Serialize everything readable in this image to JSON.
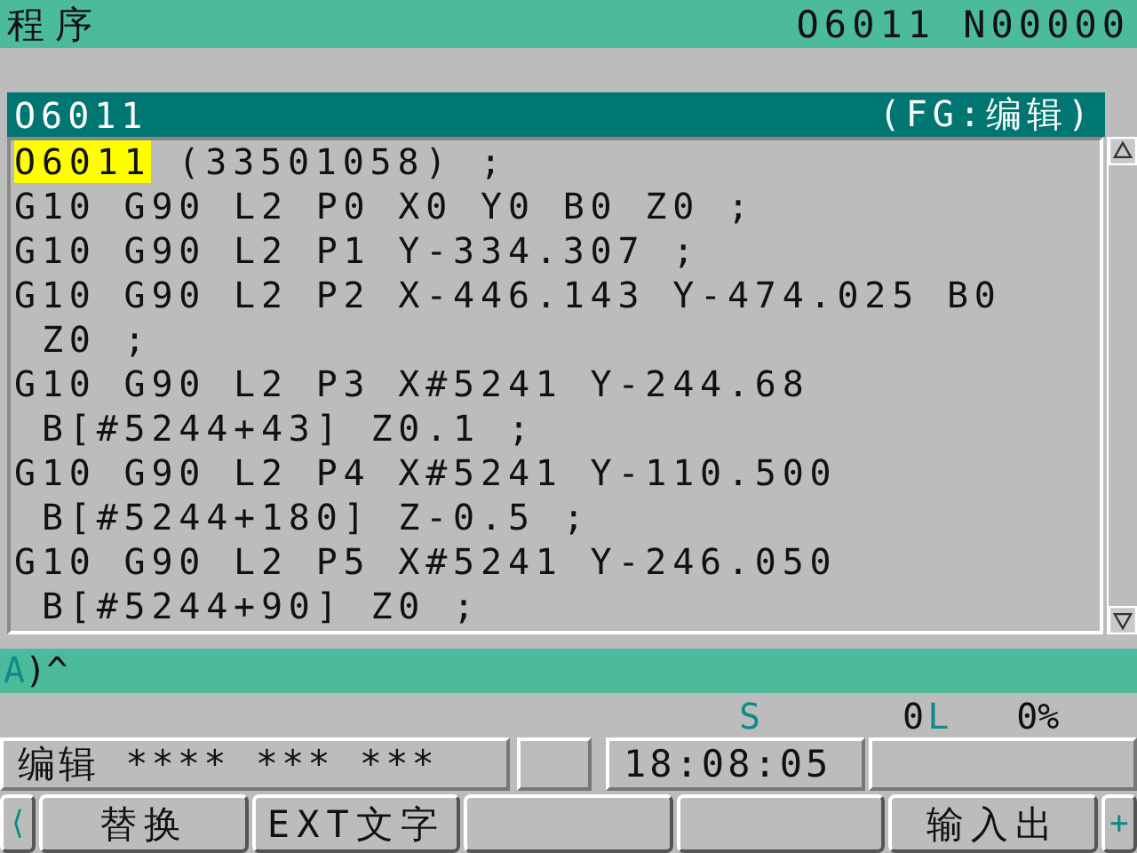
{
  "header": {
    "title": "程序",
    "program": "O6011 N00000"
  },
  "program_bar": {
    "name": "O6011",
    "mode": "(FG:编辑)"
  },
  "editor": {
    "lines": [
      {
        "cursor_word": "O6011",
        "text": "(33501058) ;"
      },
      {
        "text": "G10 G90 L2 P0 X0 Y0 B0 Z0 ;"
      },
      {
        "text": "G10 G90 L2 P1 Y-334.307 ;"
      },
      {
        "text": "G10 G90 L2 P2 X-446.143 Y-474.025 B0"
      },
      {
        "text": " Z0 ;"
      },
      {
        "text": "G10 G90 L2 P3 X#5241 Y-244.68"
      },
      {
        "text": " B[#5244+43] Z0.1 ;"
      },
      {
        "text": "G10 G90 L2 P4 X#5241 Y-110.500"
      },
      {
        "text": " B[#5244+180] Z-0.5 ;"
      },
      {
        "text": "G10 G90 L2 P5 X#5241 Y-246.050"
      },
      {
        "text": " B[#5244+90] Z0 ;"
      }
    ]
  },
  "command_line": {
    "prompt_letter": "A",
    "prompt_text": ")^"
  },
  "status_row": {
    "s_label": "S",
    "s_value": "0",
    "l_label": "L",
    "l_value": "0%"
  },
  "status_bar": {
    "mode": "编辑 **** *** ***",
    "time": "18:08:05"
  },
  "softkeys": {
    "left": "⟨",
    "keys": [
      {
        "kind": "label",
        "label": "替换"
      },
      {
        "kind": "label",
        "label": "EXT文字"
      },
      {
        "kind": "blank"
      },
      {
        "kind": "blank"
      },
      {
        "kind": "label",
        "label": "输入出"
      }
    ],
    "right": "+"
  }
}
